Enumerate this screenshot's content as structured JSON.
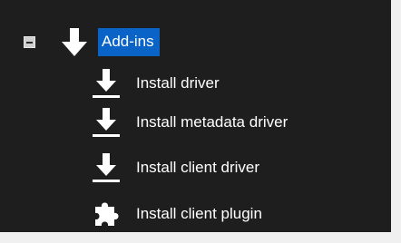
{
  "tree": {
    "root": {
      "label": "Add-ins",
      "expanded": true,
      "toggle_icon": "collapse-minus-icon",
      "icon": "download-arrow-icon",
      "selected_color": "#0a64c8"
    },
    "children": [
      {
        "label": "Install driver",
        "icon": "install-arrow-icon"
      },
      {
        "label": "Install metadata driver",
        "icon": "install-arrow-icon"
      },
      {
        "label": "Install client driver",
        "icon": "install-arrow-icon"
      },
      {
        "label": "Install client plugin",
        "icon": "puzzle-piece-icon"
      }
    ]
  },
  "colors": {
    "background": "#1e1e1e",
    "text": "#ffffff",
    "page": "#f0f0f0"
  }
}
